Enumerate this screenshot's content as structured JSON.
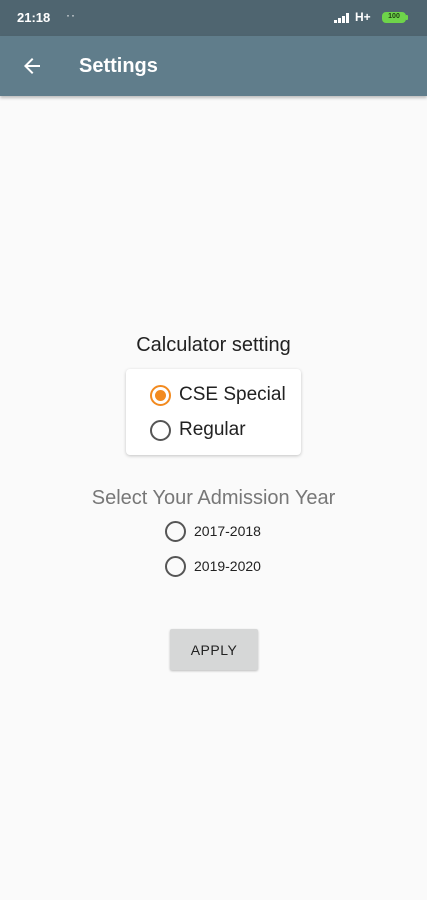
{
  "status": {
    "time": "21:18",
    "dots": "··",
    "network": "H+",
    "battery": "100"
  },
  "toolbar": {
    "title": "Settings",
    "back_icon": "arrow-left-icon"
  },
  "calculator": {
    "heading": "Calculator setting",
    "options": [
      {
        "label": "CSE Special",
        "selected": true
      },
      {
        "label": "Regular",
        "selected": false
      }
    ]
  },
  "admission": {
    "heading": "Select Your Admission Year",
    "options": [
      {
        "label": "2017-2018",
        "selected": false
      },
      {
        "label": "2019-2020",
        "selected": false
      }
    ]
  },
  "apply_button": {
    "label": "APPLY"
  },
  "colors": {
    "toolbar": "#607d8b",
    "statusbar": "#4f6570",
    "accent": "#f28a1f",
    "battery": "#6ed44a"
  }
}
